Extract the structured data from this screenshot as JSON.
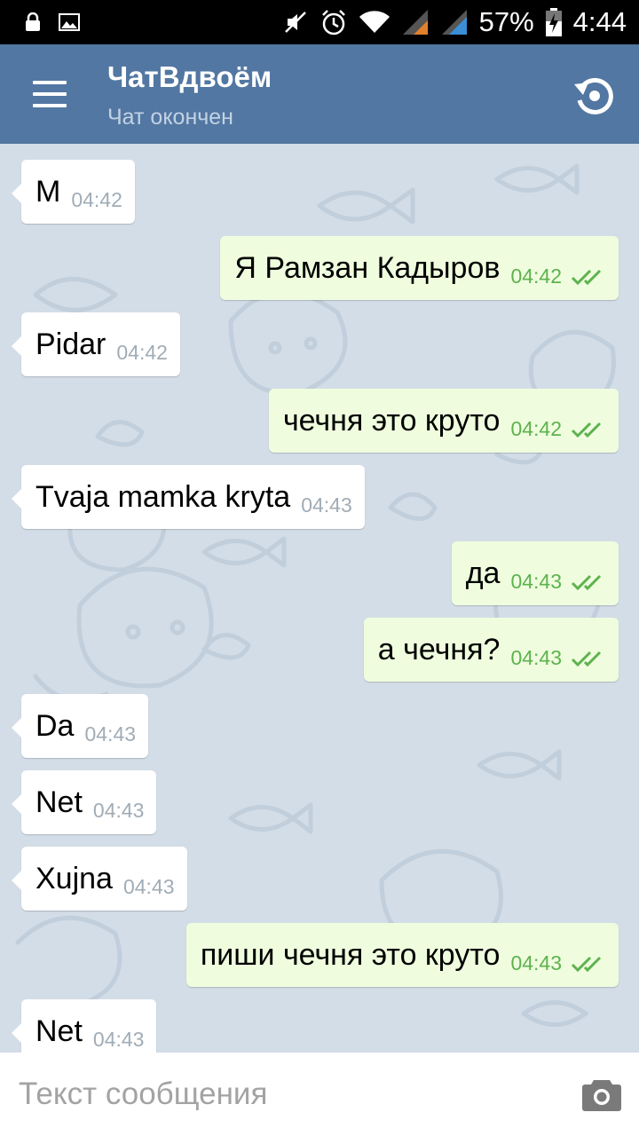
{
  "status_bar": {
    "battery": "57%",
    "time": "4:44"
  },
  "header": {
    "title": "ЧатВдвоём",
    "subtitle": "Чат окончен",
    "menu_icon": "hamburger-menu-icon",
    "action_icon": "restart-icon"
  },
  "colors": {
    "header_bg": "#5277a2",
    "chat_bg": "#d3dde7",
    "incoming_bubble": "#ffffff",
    "outgoing_bubble": "#effdde",
    "outgoing_time": "#5eb24e"
  },
  "messages": [
    {
      "dir": "in",
      "text": "M",
      "time": "04:42"
    },
    {
      "dir": "out",
      "text": "Я Рамзан Кадыров",
      "time": "04:42"
    },
    {
      "dir": "in",
      "text": "Pidar",
      "time": "04:42"
    },
    {
      "dir": "out",
      "text": "чечня это круто",
      "time": "04:42"
    },
    {
      "dir": "in",
      "text": "Tvaja mamka kryta",
      "time": "04:43"
    },
    {
      "dir": "out",
      "text": "да",
      "time": "04:43"
    },
    {
      "dir": "out",
      "text": "а чечня?",
      "time": "04:43"
    },
    {
      "dir": "in",
      "text": "Da",
      "time": "04:43"
    },
    {
      "dir": "in",
      "text": "Net",
      "time": "04:43"
    },
    {
      "dir": "in",
      "text": "Xujna",
      "time": "04:43"
    },
    {
      "dir": "out",
      "text": "пиши чечня это круто",
      "time": "04:43"
    },
    {
      "dir": "in",
      "text": "Net",
      "time": "04:43"
    }
  ],
  "composer": {
    "placeholder": "Текст сообщения",
    "value": "",
    "attach_icon": "camera-icon"
  }
}
